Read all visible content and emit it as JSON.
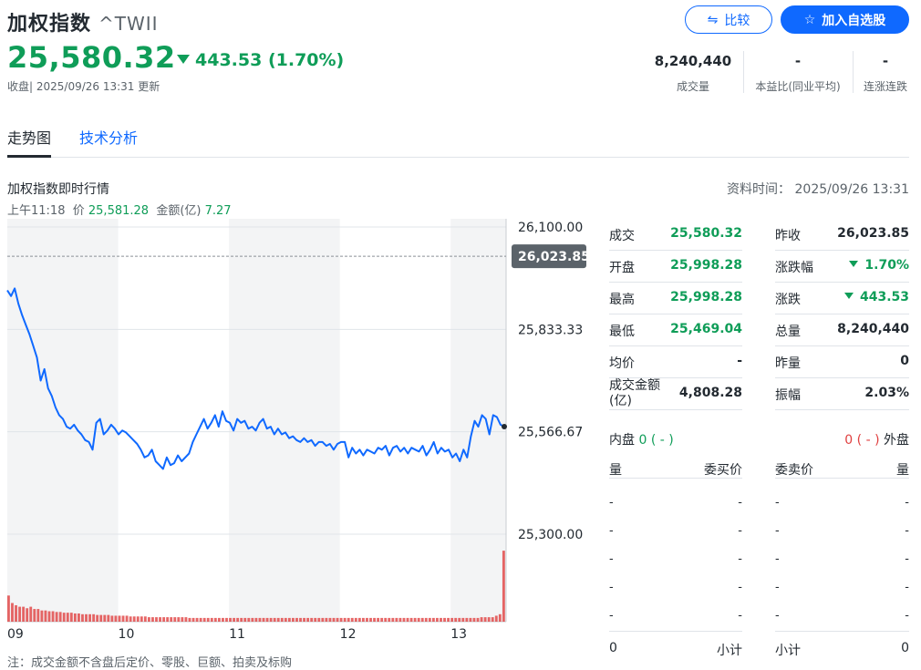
{
  "header": {
    "name": "加权指数",
    "symbol": "^TWII",
    "price": "25,580.32",
    "change": "443.53",
    "change_pct": "(1.70%)",
    "status": "收盘| 2025/09/26 13:31 更新",
    "compare_label": "比较",
    "watch_label": "加入自选股",
    "stats": [
      {
        "value": "8,240,440",
        "label": "成交量"
      },
      {
        "value": "-",
        "label": "本益比(同业平均)"
      },
      {
        "value": "-",
        "label": "连涨连跌"
      }
    ]
  },
  "tabs": [
    {
      "label": "走势图",
      "active": true
    },
    {
      "label": "技术分析",
      "active": false
    }
  ],
  "section": {
    "title": "加权指数即时行情",
    "asof_label": "资料时间：",
    "asof": "2025/09/26 13:31",
    "tip_time": "上午11:18",
    "tip_price_label": "价",
    "tip_price": "25,581.28",
    "tip_amount_label": "金额(亿)",
    "tip_amount": "7.27",
    "footnote": "注：成交金额不含盘后定价、零股、巨额、拍卖及标购"
  },
  "chart_data": {
    "type": "line",
    "y_ticks": [
      "26,100.00",
      "25,833.33",
      "25,566.67",
      "25,300.00"
    ],
    "ylim": [
      25300,
      26100
    ],
    "x_ticks": [
      "09",
      "10",
      "11",
      "12",
      "13"
    ],
    "prev_close": 26023.85,
    "prev_close_label": "26,023.85",
    "colors": {
      "line": "#0f69ff",
      "volume": "#e04040",
      "band": "#f3f4f5",
      "grid": "#e0e4e9"
    },
    "series": [
      {
        "values": [
          25935,
          25920,
          25940,
          25900,
          25870,
          25845,
          25820,
          25790,
          25760,
          25700,
          25730,
          25680,
          25660,
          25630,
          25610,
          25600,
          25580,
          25575,
          25585,
          25570,
          25560,
          25545,
          25540,
          25520,
          25590,
          25600,
          25560,
          25570,
          25585,
          25575,
          25560,
          25570,
          25565,
          25555,
          25545,
          25535,
          25520,
          25500,
          25505,
          25520,
          25490,
          25480,
          25470,
          25500,
          25480,
          25485,
          25505,
          25490,
          25500,
          25510,
          25540,
          25560,
          25580,
          25600,
          25575,
          25590,
          25610,
          25580,
          25620,
          25595,
          25590,
          25570,
          25600,
          25590,
          25595,
          25575,
          25580,
          25570,
          25590,
          25600,
          25575,
          25580,
          25560,
          25575,
          25560,
          25565,
          25550,
          25555,
          25545,
          25540,
          25550,
          25540,
          25545,
          25530,
          25540,
          25540,
          25530,
          25535,
          25520,
          25535,
          25540,
          25540,
          25500,
          25525,
          25510,
          25520,
          25505,
          25520,
          25515,
          25510,
          25525,
          25520,
          25530,
          25505,
          25525,
          25530,
          25515,
          25525,
          25510,
          25525,
          25520,
          25515,
          25530,
          25505,
          25520,
          25540,
          25510,
          25525,
          25515,
          25520,
          25500,
          25510,
          25490,
          25520,
          25500,
          25555,
          25595,
          25580,
          25610,
          25600,
          25560,
          25610,
          25605,
          25585,
          25580
        ]
      },
      {
        "name": "volume",
        "values": [
          0.35,
          0.25,
          0.22,
          0.2,
          0.2,
          0.18,
          0.2,
          0.17,
          0.17,
          0.15,
          0.15,
          0.14,
          0.14,
          0.13,
          0.13,
          0.12,
          0.12,
          0.12,
          0.11,
          0.11,
          0.1,
          0.1,
          0.1,
          0.1,
          0.09,
          0.09,
          0.09,
          0.09,
          0.08,
          0.08,
          0.08,
          0.08,
          0.08,
          0.07,
          0.07,
          0.07,
          0.07,
          0.07,
          0.06,
          0.06,
          0.06,
          0.06,
          0.06,
          0.06,
          0.06,
          0.06,
          0.06,
          0.06,
          0.06,
          0.05,
          0.05,
          0.05,
          0.05,
          0.05,
          0.05,
          0.05,
          0.05,
          0.05,
          0.05,
          0.05,
          0.05,
          0.05,
          0.05,
          0.05,
          0.05,
          0.05,
          0.05,
          0.05,
          0.05,
          0.05,
          0.05,
          0.05,
          0.05,
          0.05,
          0.05,
          0.05,
          0.05,
          0.05,
          0.05,
          0.05,
          0.05,
          0.05,
          0.05,
          0.05,
          0.05,
          0.05,
          0.05,
          0.05,
          0.05,
          0.05,
          0.05,
          0.05,
          0.05,
          0.05,
          0.05,
          0.05,
          0.05,
          0.05,
          0.05,
          0.05,
          0.05,
          0.05,
          0.05,
          0.05,
          0.05,
          0.05,
          0.05,
          0.05,
          0.05,
          0.05,
          0.05,
          0.05,
          0.05,
          0.05,
          0.05,
          0.05,
          0.05,
          0.05,
          0.05,
          0.05,
          0.05,
          0.05,
          0.05,
          0.05,
          0.05,
          0.05,
          0.05,
          0.05,
          0.06,
          0.06,
          0.06,
          0.06,
          0.08,
          0.1,
          0.95
        ]
      }
    ]
  },
  "quote": {
    "left": [
      {
        "label": "成交",
        "value": "25,580.32",
        "green": true
      },
      {
        "label": "开盘",
        "value": "25,998.28",
        "green": true
      },
      {
        "label": "最高",
        "value": "25,998.28",
        "green": true
      },
      {
        "label": "最低",
        "value": "25,469.04",
        "green": true
      },
      {
        "label": "均价",
        "value": "-",
        "green": false
      },
      {
        "label": "成交金额\n(亿)",
        "value": "4,808.28",
        "green": false
      }
    ],
    "right": [
      {
        "label": "昨收",
        "value": "26,023.85",
        "green": false,
        "tri": false
      },
      {
        "label": "涨跌幅",
        "value": "1.70%",
        "green": true,
        "tri": true
      },
      {
        "label": "涨跌",
        "value": "443.53",
        "green": true,
        "tri": true
      },
      {
        "label": "总量",
        "value": "8,240,440",
        "green": false,
        "tri": false
      },
      {
        "label": "昨量",
        "value": "0",
        "green": false,
        "tri": false
      },
      {
        "label": "振幅",
        "value": "2.03%",
        "green": false,
        "tri": false
      }
    ]
  },
  "flow": {
    "inner_label": "内盘",
    "inner_value": "0",
    "inner_pct": "( - )",
    "outer_value": "0",
    "outer_pct": "( - )",
    "outer_label": "外盘"
  },
  "orderbook": {
    "bid_headers": [
      "量",
      "委买价"
    ],
    "ask_headers": [
      "委卖价",
      "量"
    ],
    "rows": [
      "-",
      "-",
      "-",
      "-",
      "-"
    ],
    "bid_total_qty": "0",
    "subtotal_label": "小计",
    "ask_total_qty": "0"
  }
}
